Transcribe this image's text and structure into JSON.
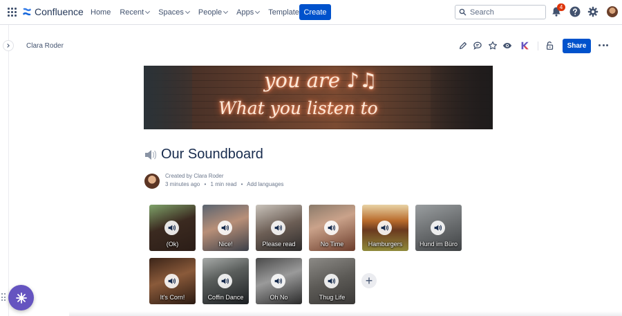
{
  "app": {
    "name": "Confluence"
  },
  "nav": {
    "items": [
      {
        "label": "Home",
        "dropdown": false
      },
      {
        "label": "Recent",
        "dropdown": true
      },
      {
        "label": "Spaces",
        "dropdown": true
      },
      {
        "label": "People",
        "dropdown": true
      },
      {
        "label": "Apps",
        "dropdown": true
      },
      {
        "label": "Templates",
        "dropdown": false
      }
    ],
    "create_label": "Create"
  },
  "search": {
    "placeholder": "Search"
  },
  "notifications": {
    "count": "4"
  },
  "breadcrumb": {
    "label": "Clara Roder"
  },
  "toolbar": {
    "share_label": "Share"
  },
  "banner": {
    "line1": "you are ♪♫",
    "line2": "What you listen to"
  },
  "page": {
    "title": "Our Soundboard",
    "byline": {
      "created_by": "Created by Clara Roder",
      "time_ago": "3 minutes ago",
      "separator": "•",
      "read_time": "1 min read",
      "add_languages": "Add languages"
    }
  },
  "soundboard": {
    "tiles": [
      {
        "label": "(Ok)",
        "bg": "linear-gradient(160deg,#7fa36a 0%,#3b2a20 45%,#2b1d17 100%)"
      },
      {
        "label": "Nice!",
        "bg": "linear-gradient(160deg,#5a6470 0%,#b88f78 45%,#3b3f48 100%)"
      },
      {
        "label": "Please read",
        "bg": "linear-gradient(160deg,#c9c3bb 0%,#6c5e55 50%,#2c2a2a 100%)"
      },
      {
        "label": "No Time",
        "bg": "linear-gradient(160deg,#8a7a6a 0%,#caa28a 40%,#6b3c2b 100%)"
      },
      {
        "label": "Hamburgers",
        "bg": "linear-gradient(180deg,#e8d3a5 0%,#b86a2b 35%,#6b3a1f 55%,#8f8a3a 100%)"
      },
      {
        "label": "Hund im Büro",
        "bg": "linear-gradient(160deg,#9a9ea0 0%,#6b6e70 50%,#3f4244 100%)"
      },
      {
        "label": "It's Corn!",
        "bg": "linear-gradient(160deg,#3b2418 0%,#8a5a3a 45%,#2a1a12 100%)"
      },
      {
        "label": "Coffin Dance",
        "bg": "linear-gradient(160deg,#a7aaa8 0%,#5a5e5c 40%,#1c1f22 100%)"
      },
      {
        "label": "Oh No",
        "bg": "linear-gradient(160deg,#4a4a4a 0%,#9a9a9a 45%,#2a2a2a 100%)"
      },
      {
        "label": "Thug Life",
        "bg": "linear-gradient(160deg,#8c8a86 0%,#5c5a56 50%,#3a3836 100%)"
      }
    ],
    "add_label": "+"
  }
}
